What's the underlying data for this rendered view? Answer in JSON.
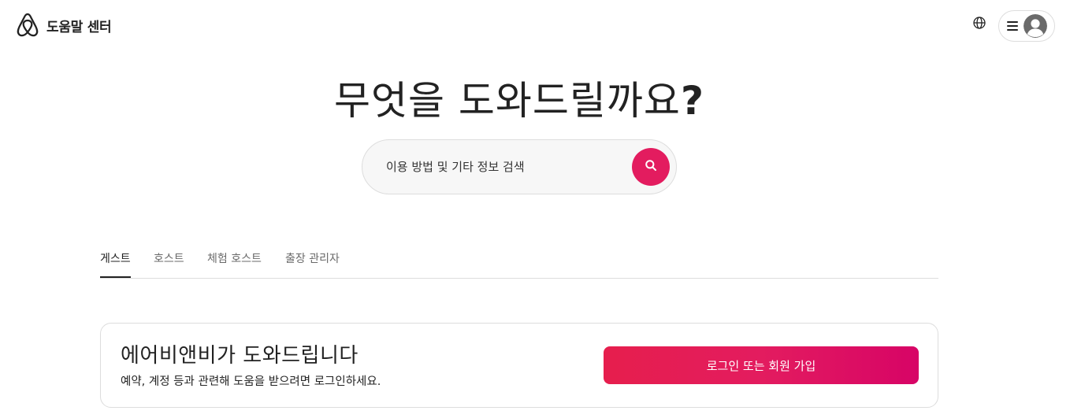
{
  "header": {
    "brand_text": "도움말 센터",
    "logo_icon": "airbnb-logo-icon",
    "globe_icon": "globe-icon",
    "menu_icon": "hamburger-menu-icon",
    "avatar_icon": "user-avatar-icon"
  },
  "hero": {
    "title_main": "무엇을 도와드릴까요",
    "title_mark": "?"
  },
  "search": {
    "placeholder": "이용 방법 및 기타 정보 검색",
    "value": "",
    "button_icon": "search-icon"
  },
  "tabs": [
    {
      "label": "게스트",
      "active": true
    },
    {
      "label": "호스트",
      "active": false
    },
    {
      "label": "체험 호스트",
      "active": false
    },
    {
      "label": "출장 관리자",
      "active": false
    }
  ],
  "login_card": {
    "title": "에어비앤비가 도와드립니다",
    "subtitle": "예약, 계정 등과 관련해 도움을 받으려면 로그인하세요.",
    "button_label": "로그인 또는 회원 가입"
  },
  "colors": {
    "brand": "#e31c5f",
    "text": "#222222",
    "border": "#dddddd",
    "search_bg": "#f7f7f7"
  }
}
